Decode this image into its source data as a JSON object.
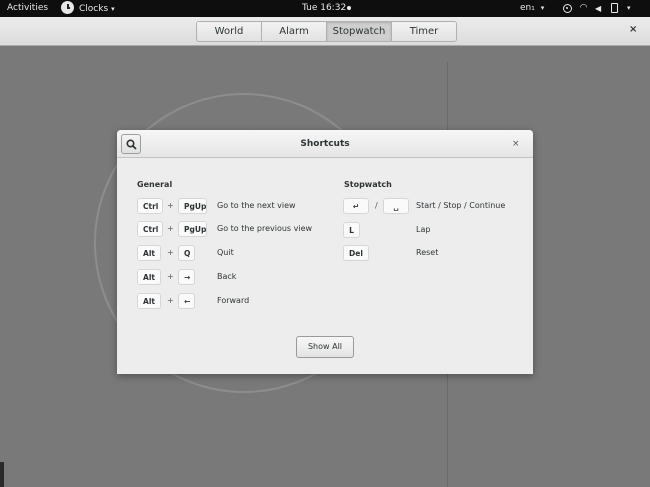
{
  "topbar": {
    "activities": "Activities",
    "app_menu": "Clocks",
    "time": "Tue 16:32",
    "language": "en₁",
    "caret": "▾"
  },
  "headerbar": {
    "tabs": [
      "World",
      "Alarm",
      "Stopwatch",
      "Timer"
    ],
    "active_tab": "Stopwatch",
    "close": "×"
  },
  "dialog": {
    "title": "Shortcuts",
    "close": "×",
    "show_all": "Show All",
    "general": {
      "title": "General",
      "plus": "+",
      "rows": [
        {
          "keys": [
            "Ctrl",
            "PgUp"
          ],
          "desc": "Go to the next view"
        },
        {
          "keys": [
            "Ctrl",
            "PgUp"
          ],
          "desc": "Go to the previous view"
        },
        {
          "keys": [
            "Alt",
            "Q"
          ],
          "desc": "Quit"
        },
        {
          "keys": [
            "Alt",
            "→"
          ],
          "desc": "Back"
        },
        {
          "keys": [
            "Alt",
            "←"
          ],
          "desc": "Forward"
        }
      ]
    },
    "stopwatch": {
      "title": "Stopwatch",
      "slash": "/",
      "rows": [
        {
          "keys": [
            "↵",
            "␣"
          ],
          "desc": "Start / Stop / Continue"
        },
        {
          "keys": [
            "L"
          ],
          "desc": "Lap"
        },
        {
          "keys": [
            "Del"
          ],
          "desc": "Reset"
        }
      ]
    }
  },
  "colors": {
    "topbar_bg": "#0e0e0e",
    "dim_background": "#797979",
    "dialog_bg": "#ededed"
  }
}
